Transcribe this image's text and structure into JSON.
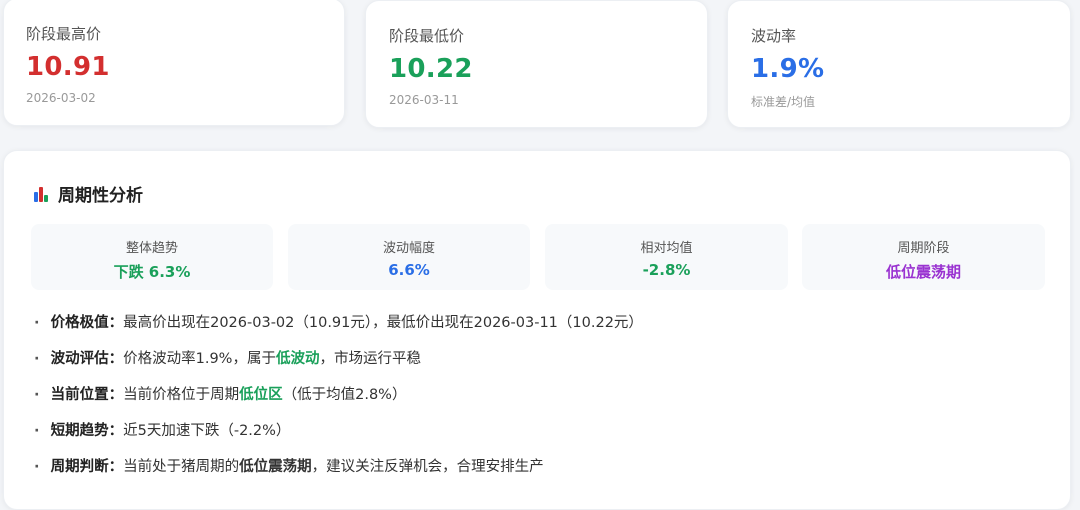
{
  "cards": {
    "high": {
      "label": "阶段最高价",
      "value": "10.91",
      "date": "2026-03-02",
      "color": "#d32f2f"
    },
    "low": {
      "label": "阶段最低价",
      "value": "10.22",
      "date": "2026-03-11",
      "color": "#1aa05a"
    },
    "volatility": {
      "label": "波动率",
      "value": "1.9%",
      "note": "标准差/均值",
      "color": "#2a6ee6"
    }
  },
  "analysis": {
    "title": "周期性分析",
    "icon": "bar-chart-icon",
    "metrics": [
      {
        "label": "整体趋势",
        "value": "下跌 6.3%"
      },
      {
        "label": "波动幅度",
        "value": "6.6%"
      },
      {
        "label": "相对均值",
        "value": "-2.8%"
      },
      {
        "label": "周期阶段",
        "value": "低位震荡期"
      }
    ],
    "bullets": [
      {
        "key": "价格极值：",
        "text": "最高价出现在2026-03-02（10.91元），最低价出现在2026-03-11（10.22元）"
      },
      {
        "key": "波动评估：",
        "pre": "价格波动率1.9%，属于",
        "em": "低波动",
        "post": "，市场运行平稳"
      },
      {
        "key": "当前位置：",
        "pre": "当前价格位于周期",
        "em": "低位区",
        "post": "（低于均值2.8%）"
      },
      {
        "key": "短期趋势：",
        "text": "近5天加速下跌（-2.2%）"
      },
      {
        "key": "周期判断：",
        "pre": "当前处于猪周期的",
        "em": "低位震荡期",
        "post": "，建议关注反弹机会，合理安排生产"
      }
    ],
    "bullet_marker": "·"
  }
}
